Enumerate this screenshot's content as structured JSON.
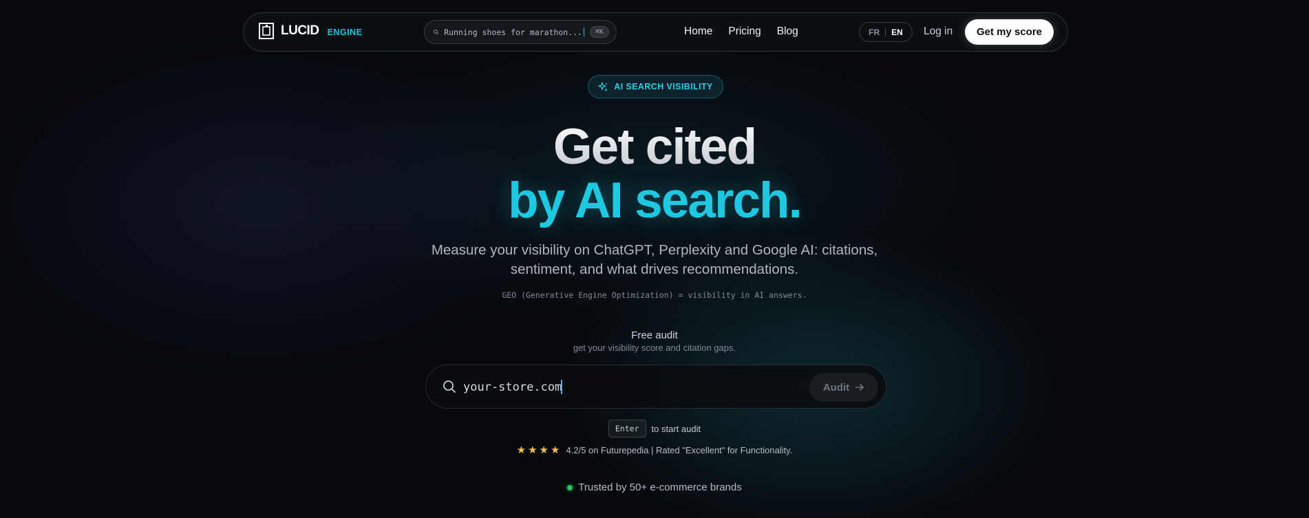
{
  "nav": {
    "logo_word": "LUCID",
    "logo_sub": "ENGINE",
    "search_text": "Running shoes for marathon...",
    "search_shortcut": "⌘K",
    "links": [
      "Home",
      "Pricing",
      "Blog"
    ],
    "lang_fr": "FR",
    "lang_en": "EN",
    "login": "Log in",
    "cta": "Get my score"
  },
  "badge": {
    "label": "AI SEARCH VISIBILITY",
    "icon": "sparkles-icon"
  },
  "hero": {
    "line1": "Get cited",
    "line2": "by AI search.",
    "subtitle_line1": "Measure your visibility on ChatGPT, Perplexity and Google AI: citations,",
    "subtitle_line2": "sentiment, and what drives recommendations.",
    "note": "GEO (Generative Engine Optimization) = visibility in AI answers."
  },
  "audit": {
    "title": "Free audit",
    "subtitle": "get your visibility score and citation gaps.",
    "input_placeholder": "your-store.com",
    "button": "Audit",
    "enter_key": "Enter",
    "enter_text": "to start audit"
  },
  "rating": {
    "stars": 4,
    "text": "4.2/5 on Futurepedia | Rated \"Excellent\" for Functionality."
  },
  "trusted": {
    "text": "Trusted by 50+ e-commerce brands",
    "dot_color": "#22c55e"
  },
  "colors": {
    "accent": "#22c3dc",
    "background": "#07090d"
  }
}
